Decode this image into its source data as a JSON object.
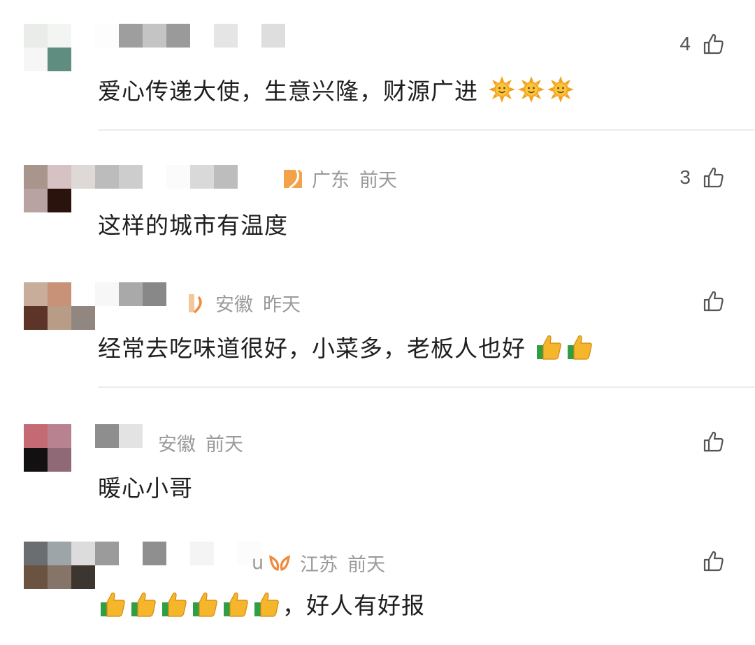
{
  "comments": [
    {
      "region": "",
      "time": "",
      "text": "爱心传递大使，生意兴隆，财源广进",
      "emoji_trailing": [
        "sun-emoji",
        "sun-emoji",
        "sun-emoji"
      ],
      "likes": "4"
    },
    {
      "region": "广东",
      "time": "前天",
      "text": "这样的城市有温度",
      "emoji_trailing": [],
      "likes": "3"
    },
    {
      "region": "安徽",
      "time": "昨天",
      "text": "经常去吃味道很好，小菜多，老板人也好",
      "emoji_trailing": [
        "thumbs-up-emoji",
        "thumbs-up-emoji"
      ],
      "likes": ""
    },
    {
      "region": "安徽",
      "time": "前天",
      "text": "暖心小哥",
      "emoji_trailing": [],
      "likes": ""
    },
    {
      "name_fragment": "u",
      "region": "江苏",
      "time": "前天",
      "text_leading_emoji": [
        "thumbs-up-emoji",
        "thumbs-up-emoji",
        "thumbs-up-emoji",
        "thumbs-up-emoji",
        "thumbs-up-emoji",
        "thumbs-up-emoji"
      ],
      "text": "，好人有好报",
      "likes": ""
    }
  ],
  "icons": {
    "like": "thumbs-up-outline-icon",
    "badge_orange": "#f4a24a",
    "badge_orange_outline": "#f08a3c"
  }
}
